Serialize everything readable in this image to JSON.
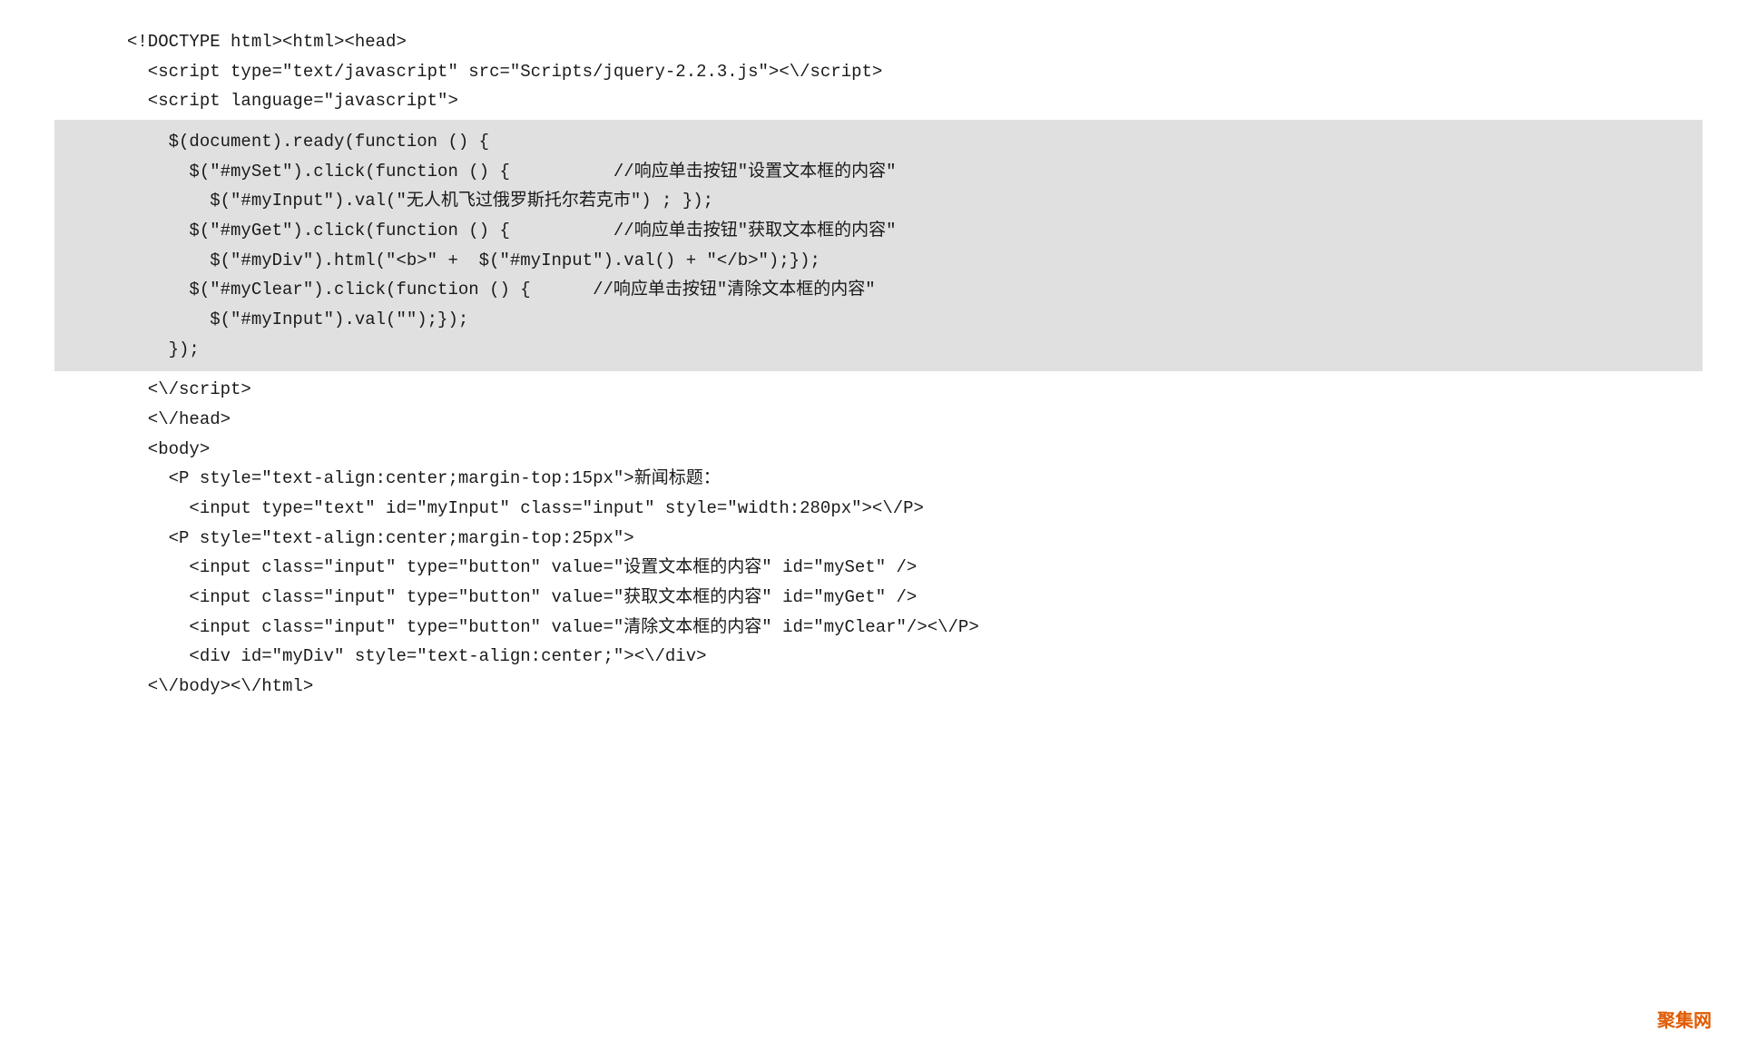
{
  "brand": "聚集网",
  "lines": {
    "l1": "<!DOCTYPE html><html><head>",
    "l2": "  <script type=\"text/javascript\" src=\"Scripts/jquery-2.2.3.js\"><\\/script>",
    "l3": "  <script language=\"javascript\">",
    "hl1": "    $(document).ready(function () {",
    "hl2": "      $(\"#mySet\").click(function () {          //响应单击按钮\"设置文本框的内容\"",
    "hl3": "        $(\"#myInput\").val(\"无人机飞过俄罗斯托尔若克市\") ; });",
    "hl4": "      $(\"#myGet\").click(function () {          //响应单击按钮\"获取文本框的内容\"",
    "hl5": "        $(\"#myDiv\").html(\"<b>\" +  $(\"#myInput\").val() + \"</b>\");});",
    "hl6": "      $(\"#myClear\").click(function () {      //响应单击按钮\"清除文本框的内容\"",
    "hl7": "        $(\"#myInput\").val(\"\");});",
    "hl8": "    });",
    "l4": "  <\\/script>",
    "l5": "  <\\/head>",
    "l6": "  <body>",
    "l7": "    <P style=\"text-align:center;margin-top:15px\">新闻标题：",
    "l8": "      <input type=\"text\" id=\"myInput\" class=\"input\" style=\"width:280px\"><\\/P>",
    "l9": "    <P style=\"text-align:center;margin-top:25px\">",
    "l10": "      <input class=\"input\" type=\"button\" value=\"设置文本框的内容\" id=\"mySet\" />",
    "l11": "      <input class=\"input\" type=\"button\" value=\"获取文本框的内容\" id=\"myGet\" />",
    "l12": "      <input class=\"input\" type=\"button\" value=\"清除文本框的内容\" id=\"myClear\"/><\\/P>",
    "l13": "      <div id=\"myDiv\" style=\"text-align:center;\"><\\/div>",
    "l14": "  <\\/body><\\/html>"
  }
}
